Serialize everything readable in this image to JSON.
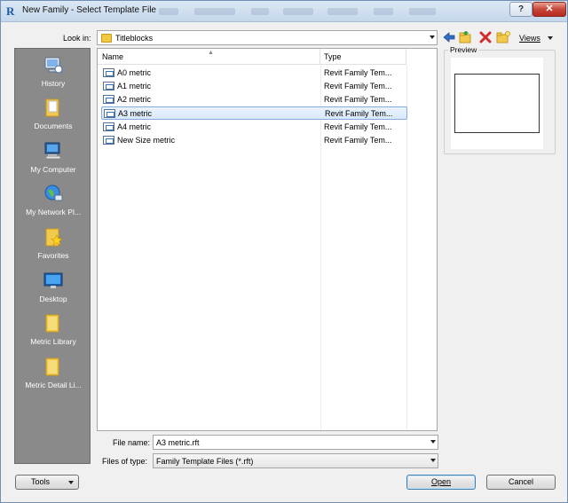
{
  "window": {
    "title": "New Family - Select Template File",
    "app_icon": "R",
    "help_label": "?",
    "close_label": "✕"
  },
  "look_in": {
    "label": "Look in:",
    "value": "Titleblocks"
  },
  "toolbar": {
    "views_label": "Views",
    "icons": [
      "back-arrow-icon",
      "up-folder-icon",
      "delete-icon",
      "new-folder-icon"
    ]
  },
  "places": [
    {
      "label": "History",
      "icon": "history-icon"
    },
    {
      "label": "Documents",
      "icon": "documents-folder-icon"
    },
    {
      "label": "My Computer",
      "icon": "computer-icon"
    },
    {
      "label": "My Network Pl...",
      "icon": "network-icon"
    },
    {
      "label": "Favorites",
      "icon": "favorites-folder-icon"
    },
    {
      "label": "Desktop",
      "icon": "desktop-icon"
    },
    {
      "label": "Metric Library",
      "icon": "folder-icon"
    },
    {
      "label": "Metric Detail Li...",
      "icon": "folder-icon"
    }
  ],
  "file_list": {
    "columns": [
      "Name",
      "Type"
    ],
    "rows": [
      {
        "name": "A0 metric",
        "type": "Revit Family Tem..."
      },
      {
        "name": "A1 metric",
        "type": "Revit Family Tem..."
      },
      {
        "name": "A2 metric",
        "type": "Revit Family Tem..."
      },
      {
        "name": "A3 metric",
        "type": "Revit Family Tem...",
        "selected": true
      },
      {
        "name": "A4 metric",
        "type": "Revit Family Tem..."
      },
      {
        "name": "New Size metric",
        "type": "Revit Family Tem..."
      }
    ]
  },
  "preview": {
    "label": "Preview"
  },
  "file_name": {
    "label": "File name:",
    "value": "A3 metric.rft"
  },
  "file_type": {
    "label": "Files of type:",
    "value": "Family Template Files  (*.rft)"
  },
  "buttons": {
    "tools": "Tools",
    "open": "Open",
    "cancel": "Cancel"
  },
  "colors": {
    "places_bg": "#8a8a8a",
    "selection": "#d8e9fb",
    "close": "#c7463a"
  }
}
